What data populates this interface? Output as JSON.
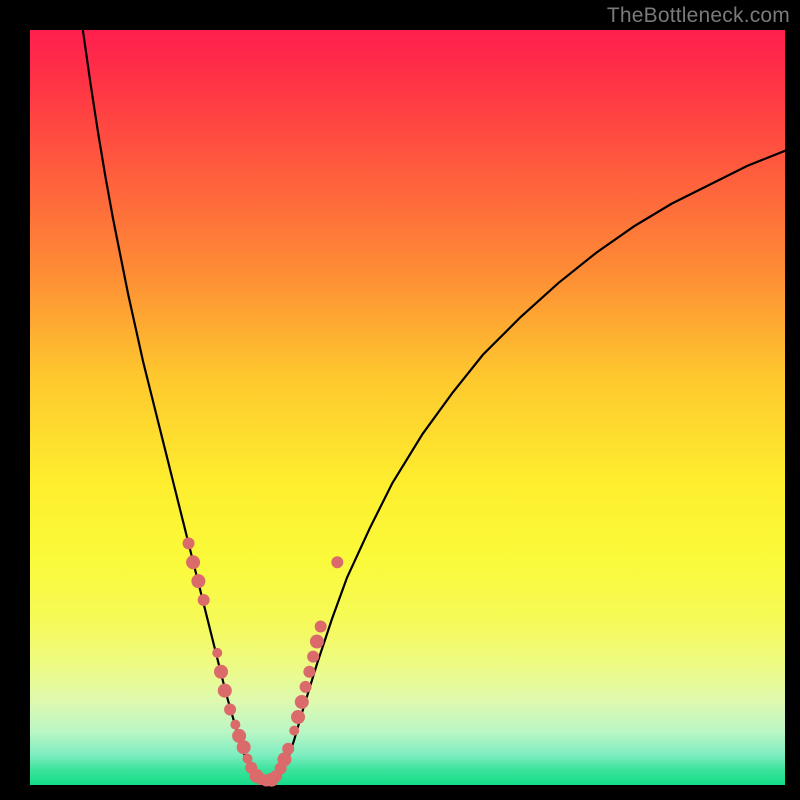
{
  "watermark": "TheBottleneck.com",
  "chart_data": {
    "type": "line",
    "title": "",
    "xlabel": "",
    "ylabel": "",
    "xlim": [
      0,
      100
    ],
    "ylim": [
      0,
      100
    ],
    "grid": false,
    "legend": false,
    "series": [
      {
        "name": "left-arm",
        "x": [
          7,
          8,
          9,
          10,
          11,
          12,
          13,
          14,
          15,
          16,
          17,
          18,
          19,
          20,
          21,
          22,
          23,
          24,
          25,
          26,
          27,
          28,
          29,
          30
        ],
        "y": [
          100,
          93,
          86.5,
          80.5,
          75,
          70,
          65,
          60.5,
          56,
          52,
          48,
          44,
          40,
          36,
          32,
          28,
          24,
          20,
          16,
          12,
          8.5,
          5,
          2.5,
          0.7
        ]
      },
      {
        "name": "valley-floor",
        "x": [
          30,
          31,
          32,
          33
        ],
        "y": [
          0.7,
          0.5,
          0.6,
          1.0
        ]
      },
      {
        "name": "right-arm",
        "x": [
          33,
          34,
          35,
          36,
          38,
          40,
          42,
          45,
          48,
          52,
          56,
          60,
          65,
          70,
          75,
          80,
          85,
          90,
          95,
          100
        ],
        "y": [
          1.0,
          3,
          6,
          9.5,
          16,
          22,
          27.5,
          34,
          40,
          46.5,
          52,
          57,
          62,
          66.5,
          70.5,
          74,
          77,
          79.5,
          82,
          84
        ]
      }
    ],
    "scatter": {
      "name": "markers",
      "points": [
        {
          "x": 21.0,
          "y": 32.0,
          "r": 6
        },
        {
          "x": 21.6,
          "y": 29.5,
          "r": 7
        },
        {
          "x": 22.3,
          "y": 27.0,
          "r": 7
        },
        {
          "x": 23.0,
          "y": 24.5,
          "r": 6
        },
        {
          "x": 24.8,
          "y": 17.5,
          "r": 5
        },
        {
          "x": 25.3,
          "y": 15.0,
          "r": 7
        },
        {
          "x": 25.8,
          "y": 12.5,
          "r": 7
        },
        {
          "x": 26.5,
          "y": 10.0,
          "r": 6
        },
        {
          "x": 27.2,
          "y": 8.0,
          "r": 5
        },
        {
          "x": 27.7,
          "y": 6.5,
          "r": 7
        },
        {
          "x": 28.3,
          "y": 5.0,
          "r": 7
        },
        {
          "x": 28.8,
          "y": 3.5,
          "r": 5
        },
        {
          "x": 29.3,
          "y": 2.3,
          "r": 6
        },
        {
          "x": 30.0,
          "y": 1.2,
          "r": 7
        },
        {
          "x": 30.6,
          "y": 0.8,
          "r": 6
        },
        {
          "x": 31.3,
          "y": 0.6,
          "r": 6
        },
        {
          "x": 32.0,
          "y": 0.7,
          "r": 7
        },
        {
          "x": 32.6,
          "y": 1.2,
          "r": 6
        },
        {
          "x": 33.2,
          "y": 2.2,
          "r": 6
        },
        {
          "x": 33.7,
          "y": 3.4,
          "r": 7
        },
        {
          "x": 34.2,
          "y": 4.8,
          "r": 6
        },
        {
          "x": 35.0,
          "y": 7.2,
          "r": 5
        },
        {
          "x": 35.5,
          "y": 9.0,
          "r": 7
        },
        {
          "x": 36.0,
          "y": 11.0,
          "r": 7
        },
        {
          "x": 36.5,
          "y": 13.0,
          "r": 6
        },
        {
          "x": 37.0,
          "y": 15.0,
          "r": 6
        },
        {
          "x": 37.5,
          "y": 17.0,
          "r": 6
        },
        {
          "x": 38.0,
          "y": 19.0,
          "r": 7
        },
        {
          "x": 38.5,
          "y": 21.0,
          "r": 6
        },
        {
          "x": 40.7,
          "y": 29.5,
          "r": 6
        }
      ]
    },
    "colors": {
      "curve": "#000000",
      "markers": "#db6b6b"
    }
  }
}
